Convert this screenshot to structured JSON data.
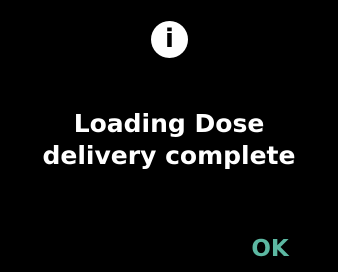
{
  "dialog": {
    "icon": "info-icon",
    "icon_glyph": "i",
    "message_line1": "Loading Dose",
    "message_line2": "delivery complete",
    "ok_label": "OK"
  },
  "colors": {
    "background": "#000000",
    "text": "#ffffff",
    "icon_background": "#ffffff",
    "accent": "#5cb8a2"
  }
}
